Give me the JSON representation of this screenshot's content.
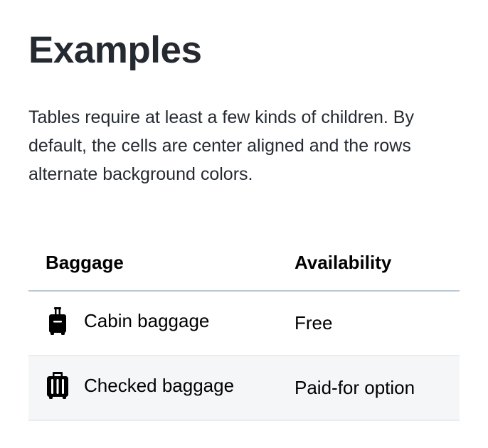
{
  "heading": {
    "title": "Examples",
    "description": "Tables require at least a few kinds of children. By default, the cells are center aligned and the rows alternate background colors."
  },
  "table": {
    "columns": [
      "Baggage",
      "Availability"
    ],
    "rows": [
      {
        "icon": "cabin-baggage-icon",
        "baggage": "Cabin baggage",
        "availability": "Free"
      },
      {
        "icon": "checked-baggage-icon",
        "baggage": "Checked baggage",
        "availability": "Paid-for option"
      }
    ]
  },
  "colors": {
    "text": "#252a31",
    "header_border": "#bac7d5",
    "row_border": "#e8edf1",
    "alt_row_background": "#f5f6f7"
  }
}
